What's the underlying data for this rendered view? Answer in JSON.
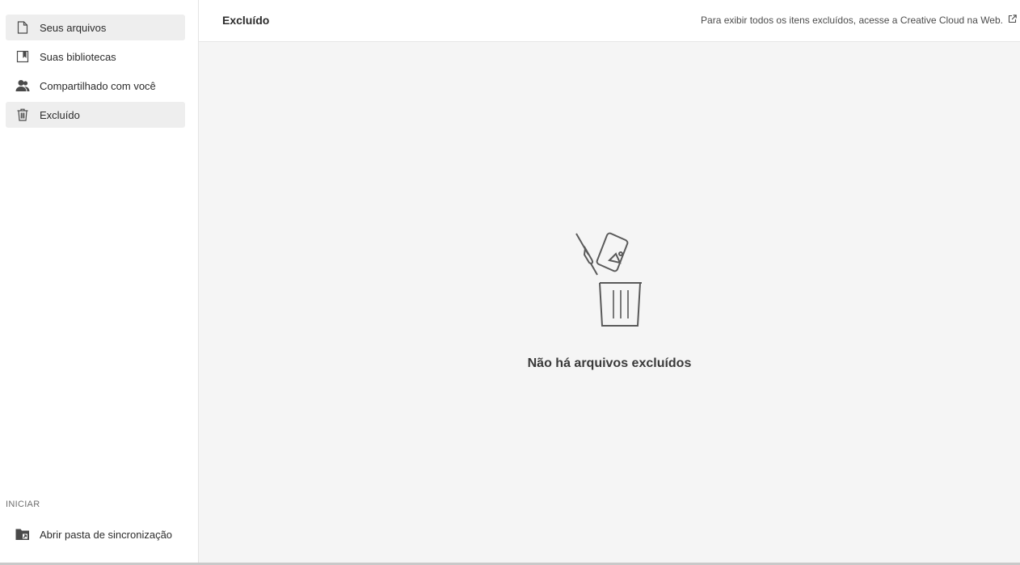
{
  "sidebar": {
    "items": [
      {
        "label": "Seus arquivos",
        "icon": "file-icon"
      },
      {
        "label": "Suas bibliotecas",
        "icon": "library-icon"
      },
      {
        "label": "Compartilhado com você",
        "icon": "users-icon"
      },
      {
        "label": "Excluído",
        "icon": "trash-icon"
      }
    ],
    "section_label": "INICIAR",
    "sync_label": "Abrir pasta de sincronização"
  },
  "header": {
    "title": "Excluído",
    "link_text": "Para exibir todos os itens excluídos, acesse a Creative Cloud na Web."
  },
  "empty_state": {
    "message": "Não há arquivos excluídos"
  },
  "colors": {
    "highlight": "#eeeeee",
    "main_background": "#f5f5f5",
    "icon_stroke": "#5a5a5a"
  }
}
